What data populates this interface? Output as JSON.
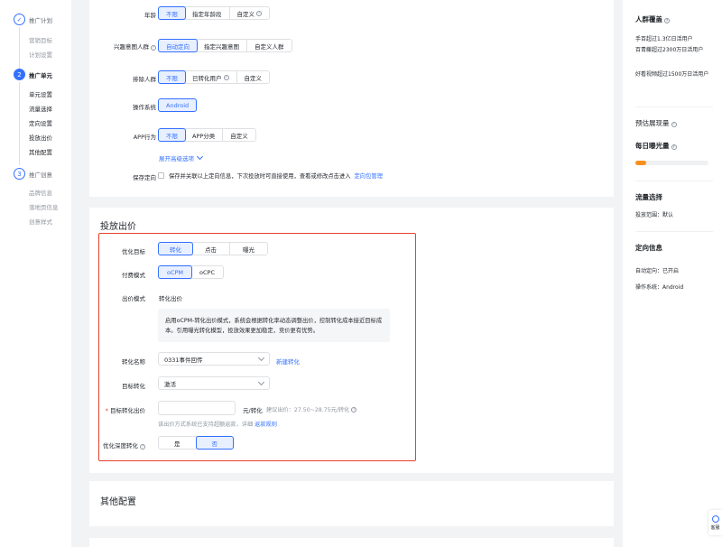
{
  "sidebar": {
    "steps": [
      {
        "num": "✓",
        "label": "推广计划",
        "subs": [
          "营销目标",
          "计划设置"
        ]
      },
      {
        "num": "2",
        "label": "推广单元",
        "subs": [
          "单元设置",
          "流量选择",
          "定向设置",
          "投放出价",
          "其他配置"
        ]
      },
      {
        "num": "3",
        "label": "推广创意",
        "subs": [
          "品牌信息",
          "落地页信息",
          "创意样式"
        ]
      }
    ]
  },
  "targeting": {
    "age": {
      "label": "年龄",
      "options": [
        "不限",
        "指定年龄段",
        "自定义"
      ]
    },
    "interest": {
      "label": "兴趣意图人群",
      "options": [
        "自动定向",
        "指定兴趣意图",
        "自定义人群"
      ]
    },
    "exclude": {
      "label": "排除人群",
      "options": [
        "不限",
        "已转化用户",
        "自定义"
      ]
    },
    "os": {
      "label": "操作系统",
      "value": "Android"
    },
    "app": {
      "label": "APP行为",
      "options": [
        "不限",
        "APP分类",
        "自定义"
      ]
    },
    "expand_link": "展开高级选项",
    "save": {
      "label": "保存定向",
      "text": "保存并关联以上定向信息，下次投放时可直接使用，查看或修改点击进入",
      "link": "定向包管理"
    }
  },
  "bidding": {
    "title": "投放出价",
    "goal": {
      "label": "优化目标",
      "options": [
        "转化",
        "点击",
        "曝光"
      ]
    },
    "pay": {
      "label": "付费模式",
      "options": [
        "oCPM",
        "oCPC"
      ]
    },
    "bid_mode": {
      "label": "出价模式",
      "value": "转化出价"
    },
    "info": "启用oCPM-转化出价模式，系统会根据转化率动态调整出价，控制转化成本接近目标成本。引用曝光转化模型，投放效果更加稳定，竞价更有优势。",
    "conv_name": {
      "label": "转化名称",
      "value": "0331事件回传",
      "link": "新建转化"
    },
    "target_conv": {
      "label": "目标转化",
      "value": "激活"
    },
    "target_bid": {
      "required": "*",
      "label": "目标转化出价",
      "unit": "元/转化",
      "suggest": "建议出价：27.50~28.75元/转化",
      "note": "该出价方式系统已支持超额返款，详细",
      "note_link": "返款规则"
    },
    "deep": {
      "label": "优化深度转化",
      "options": [
        "是",
        "否"
      ]
    }
  },
  "other": {
    "title": "其他配置"
  },
  "right_panel": {
    "audience_title": "人群覆盖",
    "audience_lines": [
      "手百超过1.3亿日活用户",
      "百青藤超过2300万日活用户",
      "好看视频超过1500万日活用户"
    ],
    "exposure_title": "预估展现量",
    "daily_title": "每日曝光量",
    "traffic_title": "流量选择",
    "traffic_value": "投放范围：默认",
    "targeting_title": "定向信息",
    "auto_target": "自动定向：已开启",
    "os_info": "操作系统：Android"
  },
  "float_btn": "客服",
  "colors": {
    "accent": "#3370ff",
    "highlight": "#e5412b",
    "progress": "#f7901e"
  }
}
